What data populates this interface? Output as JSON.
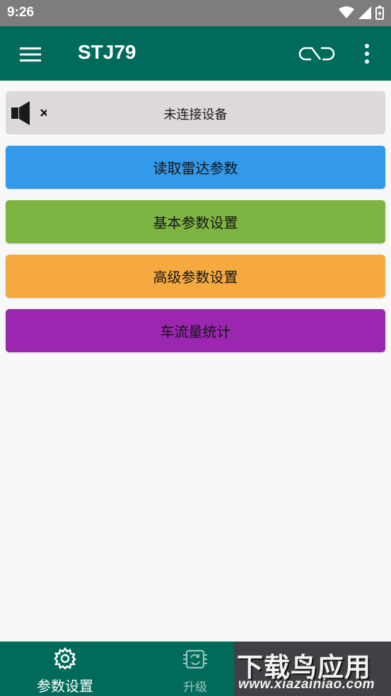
{
  "status_bar": {
    "time": "9:26"
  },
  "app_bar": {
    "title": "STJ79",
    "menu_icon": "hamburger-menu-icon",
    "link_icon": "link-icon",
    "more_icon": "more-vert-icon"
  },
  "connection": {
    "icon": "speaker-muted-icon",
    "text": "未连接设备"
  },
  "actions": [
    {
      "label": "读取雷达参数",
      "color": "#3399ea"
    },
    {
      "label": "基本参数设置",
      "color": "#7eb542"
    },
    {
      "label": "高级参数设置",
      "color": "#f6a93f"
    },
    {
      "label": "车流量统计",
      "color": "#9b27b1"
    }
  ],
  "bottom_nav": {
    "items": [
      {
        "label": "参数设置",
        "icon": "gear-icon"
      },
      {
        "label": "升级",
        "icon": "chip-update-icon"
      }
    ]
  },
  "watermark": {
    "title": "下载鸟应用",
    "url": "www.xiazainiao.com"
  },
  "colors": {
    "primary": "#006b5a",
    "status_bar": "#7d7d7d",
    "status_panel": "#ddd8da"
  }
}
